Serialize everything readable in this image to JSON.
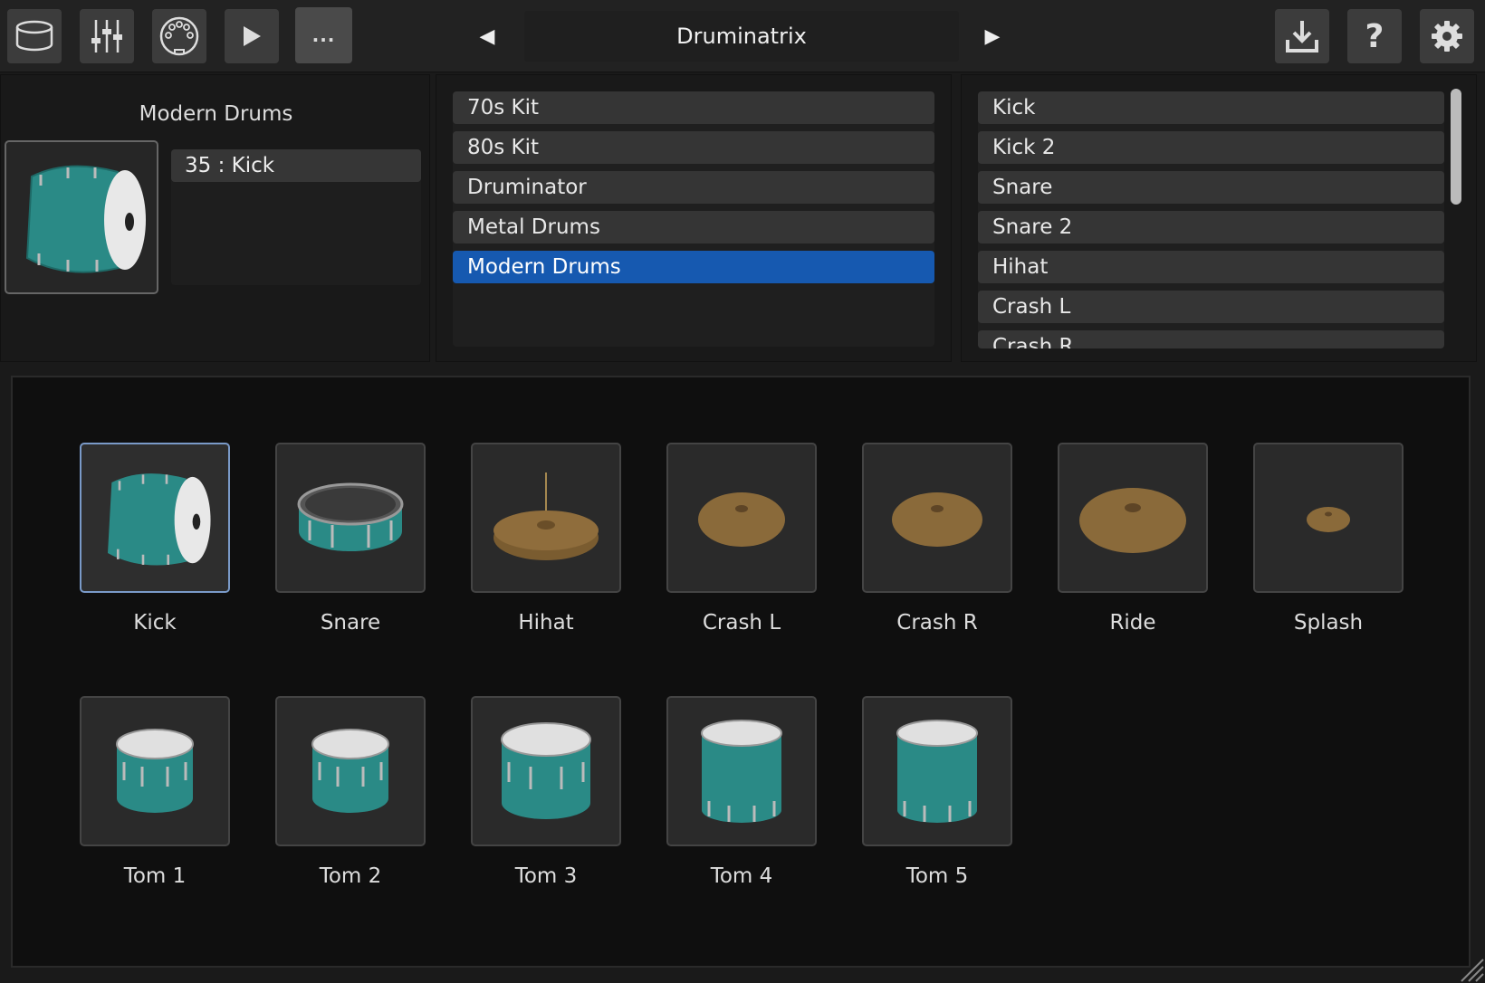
{
  "toolbar": {
    "buttons": [
      {
        "icon": "drum-icon"
      },
      {
        "icon": "mixer-icon"
      },
      {
        "icon": "midi-icon"
      },
      {
        "icon": "play-icon"
      },
      {
        "label": "..."
      }
    ],
    "prev_label": "◀",
    "preset_name": "Druminatrix",
    "next_label": "▶",
    "right_buttons": [
      {
        "icon": "download-icon"
      },
      {
        "icon": "help-icon",
        "label": "?"
      },
      {
        "icon": "gear-icon"
      }
    ]
  },
  "kit_panel": {
    "title": "Modern Drums",
    "note_items": [
      "35 : Kick"
    ]
  },
  "kit_list": {
    "items": [
      "70s Kit",
      "80s Kit",
      "Druminator",
      "Metal Drums",
      "Modern Drums"
    ],
    "selected": "Modern Drums"
  },
  "drum_list": {
    "items": [
      "Kick",
      "Kick 2",
      "Snare",
      "Snare 2",
      "Hihat",
      "Crash L",
      "Crash R"
    ]
  },
  "pads": {
    "row1": [
      "Kick",
      "Snare",
      "Hihat",
      "Crash L",
      "Crash R",
      "Ride",
      "Splash"
    ],
    "row2": [
      "Tom 1",
      "Tom 2",
      "Tom 3",
      "Tom 4",
      "Tom 5"
    ],
    "selected": "Kick"
  },
  "colors": {
    "accent": "#1659b0",
    "drum_shell": "#2a8a86",
    "cymbal": "#8a6a3a"
  }
}
